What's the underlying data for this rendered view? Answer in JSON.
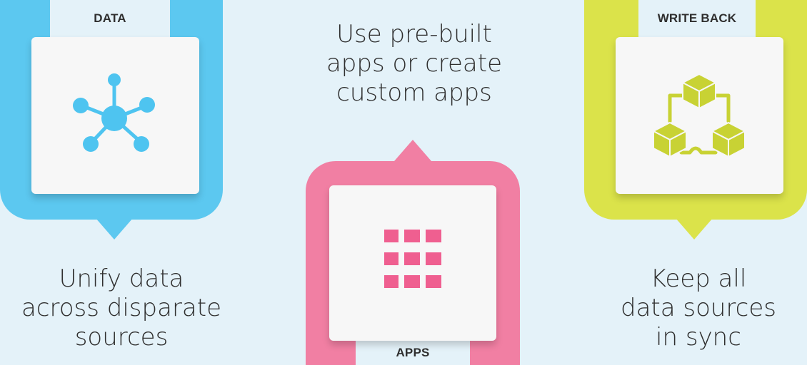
{
  "colors": {
    "background": "#e4f2f9",
    "data_accent": "#5cc8f0",
    "apps_accent": "#f17fa3",
    "write_back_accent": "#dbe34a"
  },
  "cards": {
    "data": {
      "label": "DATA",
      "icon": "hub-network-icon",
      "caption": [
        "Unify data",
        "across disparate",
        "sources"
      ]
    },
    "apps": {
      "label": "APPS",
      "icon": "app-grid-icon",
      "caption": [
        "Use pre-built",
        "apps or create",
        "custom apps"
      ]
    },
    "write_back": {
      "label": "WRITE BACK",
      "icon": "linked-cubes-icon",
      "caption": [
        "Keep all",
        "data sources",
        "in sync"
      ]
    }
  }
}
